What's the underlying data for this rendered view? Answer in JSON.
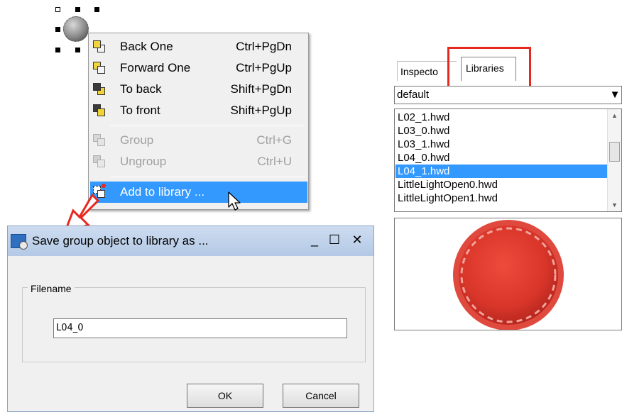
{
  "context_menu": {
    "items": [
      {
        "label": "Back One",
        "shortcut": "Ctrl+PgDn",
        "icon": "back-one-icon",
        "enabled": true
      },
      {
        "label": "Forward One",
        "shortcut": "Ctrl+PgUp",
        "icon": "forward-one-icon",
        "enabled": true
      },
      {
        "label": "To back",
        "shortcut": "Shift+PgDn",
        "icon": "to-back-icon",
        "enabled": true
      },
      {
        "label": "To front",
        "shortcut": "Shift+PgUp",
        "icon": "to-front-icon",
        "enabled": true
      },
      {
        "label": "Group",
        "shortcut": "Ctrl+G",
        "icon": "group-icon",
        "enabled": false
      },
      {
        "label": "Ungroup",
        "shortcut": "Ctrl+U",
        "icon": "ungroup-icon",
        "enabled": false
      },
      {
        "label": "Add to library ...",
        "shortcut": "",
        "icon": "add-to-library-icon",
        "enabled": true,
        "highlighted": true
      }
    ]
  },
  "panel": {
    "tabs": [
      "Inspecto",
      "Libraries"
    ],
    "library_select": "default",
    "library_files": [
      "L02_1.hwd",
      "L03_0.hwd",
      "L03_1.hwd",
      "L04_0.hwd",
      "L04_1.hwd",
      "LittleLightOpen0.hwd",
      "LittleLightOpen1.hwd"
    ],
    "selected_file": "L04_1.hwd"
  },
  "dialog": {
    "title": "Save group object to library as ...",
    "group_label": "Filename",
    "filename_value": "L04_0",
    "ok_label": "OK",
    "cancel_label": "Cancel",
    "minimize_label": "_",
    "maximize_label": "☐",
    "close_label": "✕"
  },
  "colors": {
    "highlight": "#3399ff",
    "annotation_red": "#e8281e",
    "preview_red": "#d9362a"
  }
}
